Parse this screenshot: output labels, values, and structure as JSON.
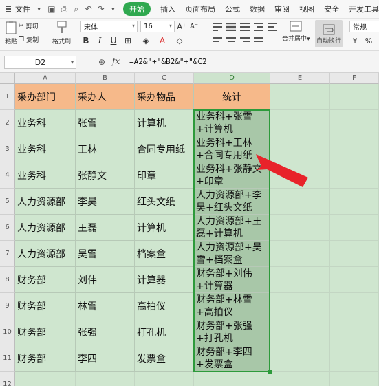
{
  "menubar": {
    "file_label": "文件",
    "tabs": [
      "开始",
      "插入",
      "页面布局",
      "公式",
      "数据",
      "审阅",
      "视图",
      "安全",
      "开发工具"
    ],
    "active_tab": "开始"
  },
  "ribbon": {
    "paste_label": "粘贴",
    "cut_label": "剪切",
    "copy_label": "复制",
    "format_painter_label": "格式刷",
    "font_name": "宋体",
    "font_size": "16",
    "bold": "B",
    "italic": "I",
    "underline": "U",
    "merge_label": "合并居中",
    "autowrap_label": "自动换行",
    "number_format": "常规",
    "percent": "%"
  },
  "formula_bar": {
    "cell_ref": "D2",
    "fx": "fx",
    "formula": "=A2&\"+\"&B2&\"+\"&C2"
  },
  "columns": [
    "A",
    "B",
    "C",
    "D",
    "E",
    "F"
  ],
  "row_numbers": [
    "1",
    "2",
    "3",
    "4",
    "5",
    "6",
    "7",
    "8",
    "9",
    "10",
    "11",
    "12"
  ],
  "headers": [
    "采办部门",
    "采办人",
    "采办物品",
    "统计"
  ],
  "rows": [
    [
      "业务科",
      "张雪",
      "计算机",
      "业务科+张雪+计算机"
    ],
    [
      "业务科",
      "王林",
      "合同专用纸",
      "业务科+王林+合同专用纸"
    ],
    [
      "业务科",
      "张静文",
      "印章",
      "业务科+张静文+印章"
    ],
    [
      "人力资源部",
      "李昊",
      "红头文纸",
      "人力资源部+李昊+红头文纸"
    ],
    [
      "人力资源部",
      "王磊",
      "计算机",
      "人力资源部+王磊+计算机"
    ],
    [
      "人力资源部",
      "吴雪",
      "档案盒",
      "人力资源部+吴雪+档案盒"
    ],
    [
      "财务部",
      "刘伟",
      "计算器",
      "财务部+刘伟+计算器"
    ],
    [
      "财务部",
      "林雪",
      "高拍仪",
      "财务部+林雪+高拍仪"
    ],
    [
      "财务部",
      "张强",
      "打孔机",
      "财务部+张强+打孔机"
    ],
    [
      "财务部",
      "李四",
      "发票盒",
      "财务部+李四+发票盒"
    ]
  ],
  "colors": {
    "header_fill": "#f6b98a",
    "body_fill": "#cfe6cf",
    "selection_fill": "#a8c7a8",
    "accent": "#2fa84f",
    "arrow": "#e8232a"
  },
  "icons": [
    "menu-icon",
    "save-icon",
    "print-icon",
    "preview-icon",
    "undo-icon",
    "redo-icon",
    "zoom-icon",
    "arrow-annotation"
  ]
}
